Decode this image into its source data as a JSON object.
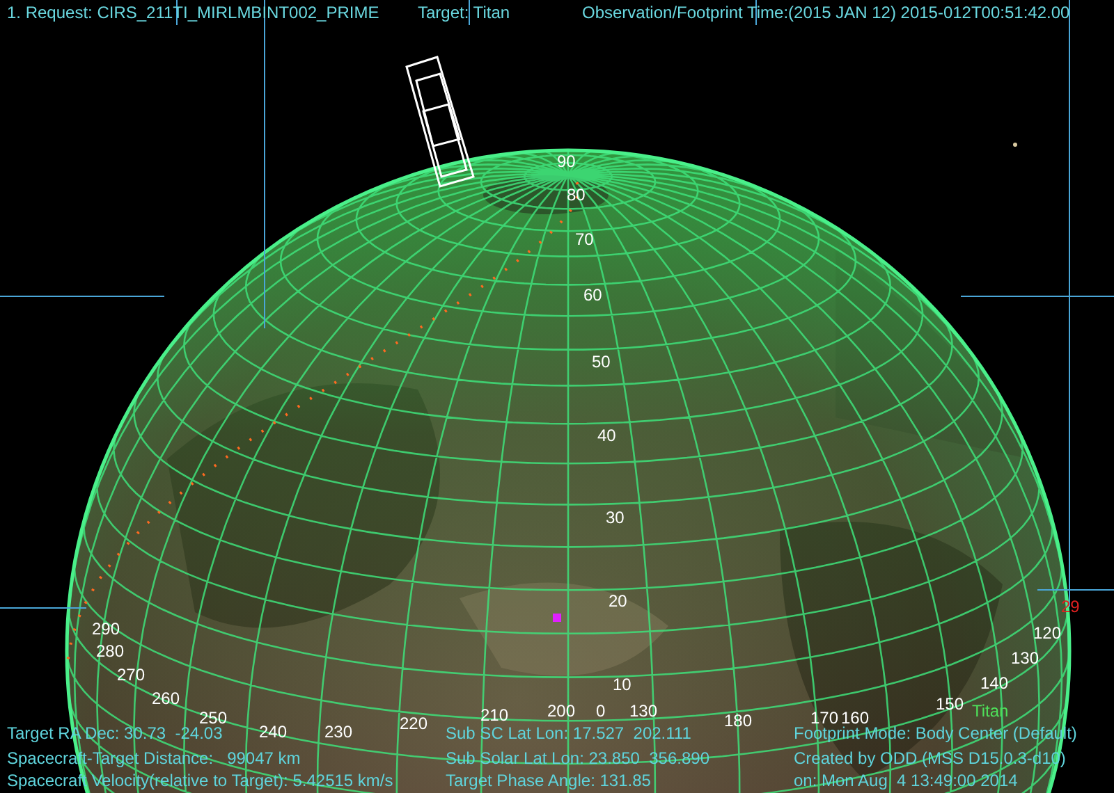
{
  "header": {
    "request": "1. Request: CIRS_211TI_MIRLMBINT002_PRIME",
    "target": "Target: Titan",
    "time": "Observation/Footprint Time:(2015 JAN 12) 2015-012T00:51:42.00"
  },
  "latitude_labels": [
    "90",
    "80",
    "70",
    "60",
    "50",
    "40",
    "30",
    "20",
    "10"
  ],
  "longitude_labels": [
    "290",
    "280",
    "270",
    "260",
    "250",
    "240",
    "230",
    "220",
    "210",
    "200",
    "0",
    "130",
    "180",
    "170",
    "160",
    "150",
    "140",
    "130",
    "120"
  ],
  "body_label": "Titan",
  "marker_label": "29",
  "info": [
    {
      "text": "Target RA Dec: 30.73  -24.03"
    },
    {
      "text": "Spacecraft-Target Distance:   99047 km"
    },
    {
      "text": "Spacecraft Velocity(relative to Target): 5.42515 km/s"
    },
    {
      "text": "Sub SC Lat Lon: 17.527  202.111"
    },
    {
      "text": "Sub Solar Lat Lon: 23.850  356.890"
    },
    {
      "text": "Target Phase Angle: 131.85"
    },
    {
      "text": "Footprint Mode: Body Center (Default)"
    },
    {
      "text": "Created by ODD (MSS D15.0.3-d10)"
    },
    {
      "text": "on: Mon Aug  4 13:49:00 2014"
    }
  ]
}
